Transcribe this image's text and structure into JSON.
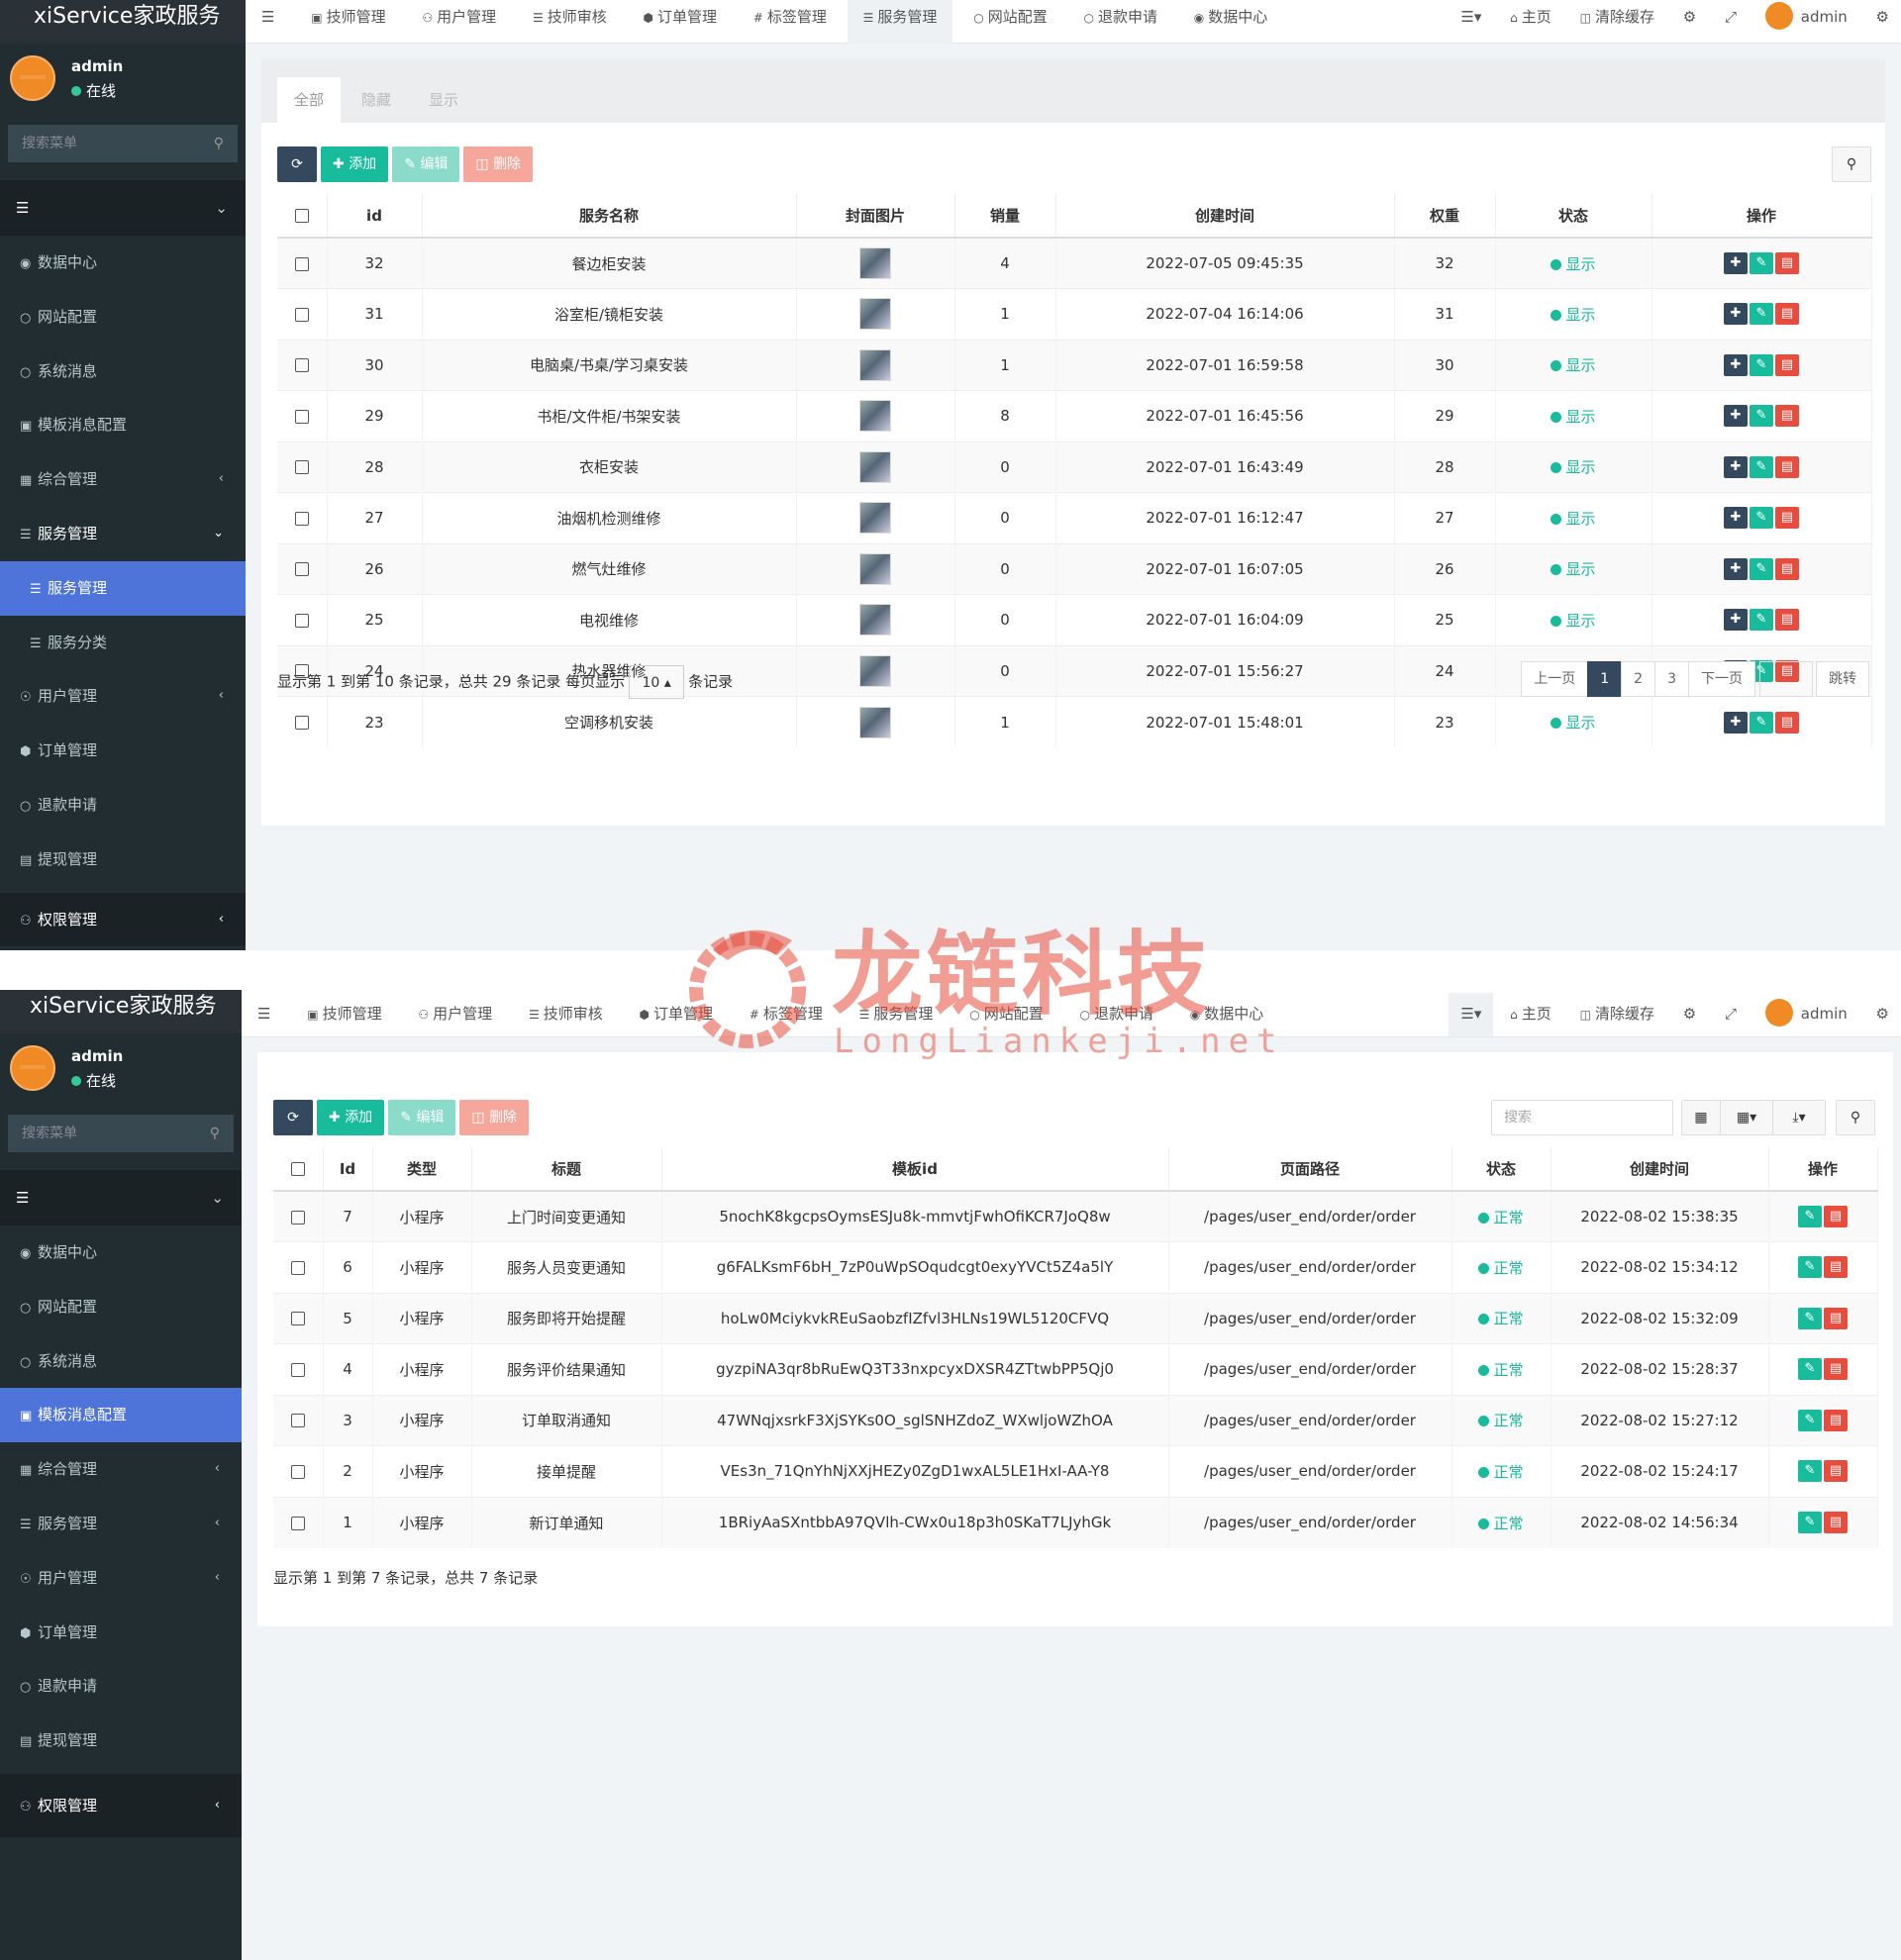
{
  "app": {
    "brand": "xiService家政服务"
  },
  "user": {
    "name": "admin",
    "status": "在线"
  },
  "sidebar": {
    "search_placeholder": "搜索菜单",
    "items": [
      {
        "label": "数据中心",
        "icon": "dashboard-icon"
      },
      {
        "label": "网站配置",
        "icon": "circle-icon"
      },
      {
        "label": "系统消息",
        "icon": "circle-icon"
      },
      {
        "label": "模板消息配置",
        "icon": "template-icon"
      },
      {
        "label": "综合管理",
        "icon": "grid-icon"
      },
      {
        "label": "服务管理",
        "icon": "list-icon"
      },
      {
        "label": "服务管理",
        "icon": "list-icon"
      },
      {
        "label": "服务分类",
        "icon": "list-icon"
      },
      {
        "label": "用户管理",
        "icon": "user-icon"
      },
      {
        "label": "订单管理",
        "icon": "cube-icon"
      },
      {
        "label": "退款申请",
        "icon": "circle-icon"
      },
      {
        "label": "提现管理",
        "icon": "money-icon"
      },
      {
        "label": "权限管理",
        "icon": "users-icon"
      }
    ]
  },
  "topnav": {
    "items": [
      "技师管理",
      "用户管理",
      "技师审核",
      "订单管理",
      "标签管理",
      "服务管理",
      "网站配置",
      "退款申请",
      "数据中心"
    ],
    "right": {
      "home": "主页",
      "clear_cache": "清除缓存",
      "user": "admin"
    }
  },
  "screen1": {
    "tabs": [
      "全部",
      "隐藏",
      "显示"
    ],
    "toolbar": {
      "add": "添加",
      "edit": "编辑",
      "delete": "删除"
    },
    "columns": [
      "id",
      "服务名称",
      "封面图片",
      "销量",
      "创建时间",
      "权重",
      "状态",
      "操作"
    ],
    "rows": [
      {
        "id": "32",
        "name": "餐边柜安装",
        "sales": "4",
        "time": "2022-07-05 09:45:35",
        "weight": "32",
        "status": "显示"
      },
      {
        "id": "31",
        "name": "浴室柜/镜柜安装",
        "sales": "1",
        "time": "2022-07-04 16:14:06",
        "weight": "31",
        "status": "显示"
      },
      {
        "id": "30",
        "name": "电脑桌/书桌/学习桌安装",
        "sales": "1",
        "time": "2022-07-01 16:59:58",
        "weight": "30",
        "status": "显示"
      },
      {
        "id": "29",
        "name": "书柜/文件柜/书架安装",
        "sales": "8",
        "time": "2022-07-01 16:45:56",
        "weight": "29",
        "status": "显示"
      },
      {
        "id": "28",
        "name": "衣柜安装",
        "sales": "0",
        "time": "2022-07-01 16:43:49",
        "weight": "28",
        "status": "显示"
      },
      {
        "id": "27",
        "name": "油烟机检测维修",
        "sales": "0",
        "time": "2022-07-01 16:12:47",
        "weight": "27",
        "status": "显示"
      },
      {
        "id": "26",
        "name": "燃气灶维修",
        "sales": "0",
        "time": "2022-07-01 16:07:05",
        "weight": "26",
        "status": "显示"
      },
      {
        "id": "25",
        "name": "电视维修",
        "sales": "0",
        "time": "2022-07-01 16:04:09",
        "weight": "25",
        "status": "显示"
      },
      {
        "id": "24",
        "name": "热水器维修",
        "sales": "0",
        "time": "2022-07-01 15:56:27",
        "weight": "24",
        "status": "显示"
      },
      {
        "id": "23",
        "name": "空调移机安装",
        "sales": "1",
        "time": "2022-07-01 15:48:01",
        "weight": "23",
        "status": "显示"
      }
    ],
    "pagination": {
      "info_pre": "显示第 1 到第 10 条记录，总共 29 条记录 每页显示",
      "page_size": "10",
      "info_post": "条记录",
      "prev": "上一页",
      "pages": [
        "1",
        "2",
        "3"
      ],
      "next": "下一页",
      "jump": "跳转"
    }
  },
  "screen2": {
    "toolbar": {
      "add": "添加",
      "edit": "编辑",
      "delete": "删除",
      "search_placeholder": "搜索"
    },
    "columns": [
      "Id",
      "类型",
      "标题",
      "模板id",
      "页面路径",
      "状态",
      "创建时间",
      "操作"
    ],
    "rows": [
      {
        "id": "7",
        "type": "小程序",
        "title": "上门时间变更通知",
        "tpl": "5nochK8kgcpsOymsESJu8k-mmvtjFwhOfiKCR7JoQ8w",
        "path": "/pages/user_end/order/order",
        "status": "正常",
        "time": "2022-08-02 15:38:35"
      },
      {
        "id": "6",
        "type": "小程序",
        "title": "服务人员变更通知",
        "tpl": "g6FALKsmF6bH_7zP0uWpSOqudcgt0exyYVCt5Z4a5lY",
        "path": "/pages/user_end/order/order",
        "status": "正常",
        "time": "2022-08-02 15:34:12"
      },
      {
        "id": "5",
        "type": "小程序",
        "title": "服务即将开始提醒",
        "tpl": "hoLw0MciykvkREuSaobzfIZfvl3HLNs19WL5120CFVQ",
        "path": "/pages/user_end/order/order",
        "status": "正常",
        "time": "2022-08-02 15:32:09"
      },
      {
        "id": "4",
        "type": "小程序",
        "title": "服务评价结果通知",
        "tpl": "gyzpiNA3qr8bRuEwQ3T33nxpcyxDXSR4ZTtwbPP5Qj0",
        "path": "/pages/user_end/order/order",
        "status": "正常",
        "time": "2022-08-02 15:28:37"
      },
      {
        "id": "3",
        "type": "小程序",
        "title": "订单取消通知",
        "tpl": "47WNqjxsrkF3XjSYKs0O_sglSNHZdoZ_WXwljoWZhOA",
        "path": "/pages/user_end/order/order",
        "status": "正常",
        "time": "2022-08-02 15:27:12"
      },
      {
        "id": "2",
        "type": "小程序",
        "title": "接单提醒",
        "tpl": "VEs3n_71QnYhNjXXjHEZy0ZgD1wxAL5LE1HxI-AA-Y8",
        "path": "/pages/user_end/order/order",
        "status": "正常",
        "time": "2022-08-02 15:24:17"
      },
      {
        "id": "1",
        "type": "小程序",
        "title": "新订单通知",
        "tpl": "1BRiyAaSXntbbA97QVlh-CWx0u18p3h0SKaT7LJyhGk",
        "path": "/pages/user_end/order/order",
        "status": "正常",
        "time": "2022-08-02 14:56:34"
      }
    ],
    "pagination_info": "显示第 1 到第 7 条记录，总共 7 条记录"
  },
  "watermark": {
    "cn": "龙链科技",
    "en": "LongLiankeji.net"
  },
  "colors": {
    "sidebar": "#222d32",
    "active": "#4f74d9",
    "primary": "#18bc9c",
    "danger": "#e74c3c",
    "dark": "#34495e"
  }
}
